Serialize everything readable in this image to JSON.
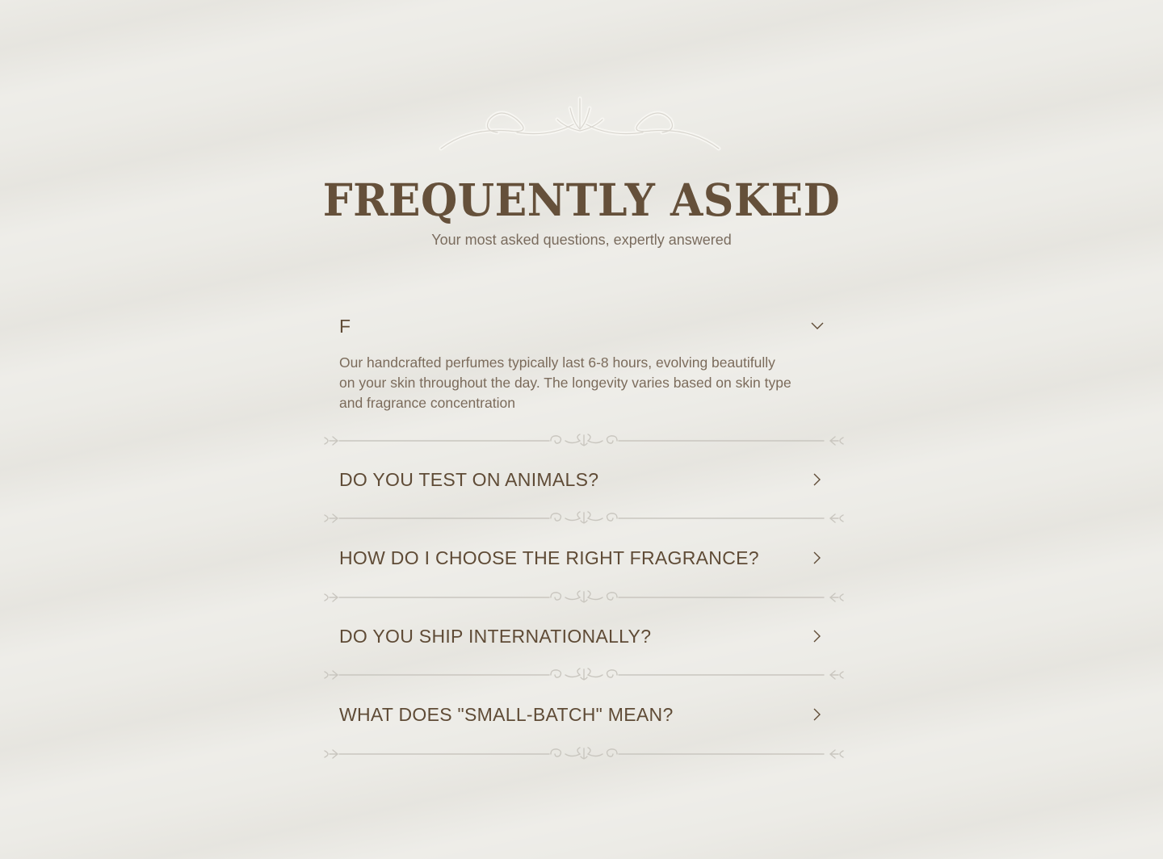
{
  "header": {
    "ornament_icon": "scroll-ornament-icon",
    "title": "FREQUENTLY ASKED",
    "subtitle": "Your most asked questions, expertly answered"
  },
  "faq": {
    "items": [
      {
        "question": "F",
        "expanded": true,
        "answer": "Our handcrafted perfumes typically last 6-8 hours, evolving beautifully on your skin throughout the day. The longevity varies based on skin type and fragrance concentration",
        "icon": "chevron-down-icon"
      },
      {
        "question": "DO YOU TEST ON ANIMALS?",
        "expanded": false,
        "icon": "chevron-right-icon"
      },
      {
        "question": "HOW DO I CHOOSE THE RIGHT FRAGRANCE?",
        "expanded": false,
        "icon": "chevron-right-icon"
      },
      {
        "question": "DO YOU SHIP INTERNATIONALLY?",
        "expanded": false,
        "icon": "chevron-right-icon"
      },
      {
        "question": "WHAT DOES \"SMALL-BATCH\" MEAN?",
        "expanded": false,
        "icon": "chevron-right-icon"
      }
    ],
    "divider_icon": "flourish-divider-icon"
  },
  "colors": {
    "background": "#ecebe6",
    "title": "#65503a",
    "question": "#5f4b36",
    "body_text": "#7b6b5b",
    "divider": "#c9c6bf"
  }
}
